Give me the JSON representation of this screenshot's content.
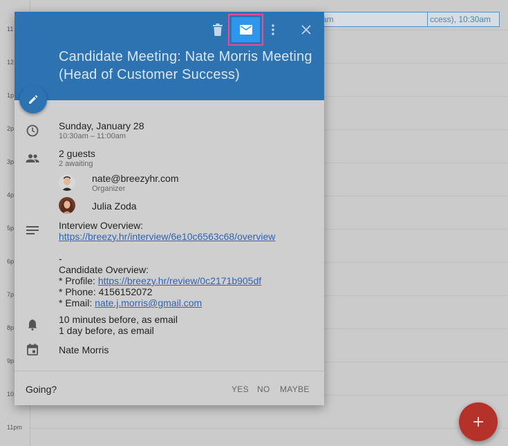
{
  "calendar": {
    "hours": [
      "11",
      "12",
      "1p",
      "2p",
      "3p",
      "4p",
      "5p",
      "6p",
      "7p",
      "8p",
      "9p",
      "10",
      "11pm"
    ],
    "bg_events": [
      "am",
      "ccess), 10:30am"
    ]
  },
  "event": {
    "title": "Candidate Meeting: Nate Morris Meeting (Head of Customer Success)",
    "date": "Sunday, January 28",
    "time": "10:30am – 11:00am",
    "guests_count": "2 guests",
    "guests_status": "2 awaiting",
    "guests": [
      {
        "name": "nate@breezyhr.com",
        "role": "Organizer"
      },
      {
        "name": "Julia Zoda",
        "role": ""
      }
    ],
    "description": {
      "interview_label": "Interview Overview:",
      "interview_link": "https://breezy.hr/interview/6e10c6563c68/overview",
      "separator": "-",
      "candidate_label": "Candidate Overview:",
      "profile_prefix": "* Profile: ",
      "profile_link": "https://breezy.hr/review/0c2171b905df",
      "phone": "* Phone: 4156152072",
      "email_prefix": "* Email: ",
      "email_link": "nate.j.morris@gmail.com"
    },
    "reminders": [
      "10 minutes before, as email",
      "1 day before, as email"
    ],
    "calendar_name": "Nate Morris"
  },
  "rsvp": {
    "question": "Going?",
    "yes": "YES",
    "no": "NO",
    "maybe": "MAYBE"
  },
  "icons": {
    "header": [
      "trash-icon",
      "mail-icon",
      "more-vert-icon",
      "close-icon"
    ],
    "rows": [
      "clock-icon",
      "people-icon",
      "notes-icon",
      "bell-icon",
      "calendar-icon"
    ],
    "fabs": [
      "pencil-icon",
      "plus-icon"
    ]
  },
  "colors": {
    "header": "#2d72b1",
    "mail_button": "#2d96ee",
    "highlight": "#e74c9b",
    "link": "#2f63b3",
    "add_fab": "#b5322b"
  }
}
